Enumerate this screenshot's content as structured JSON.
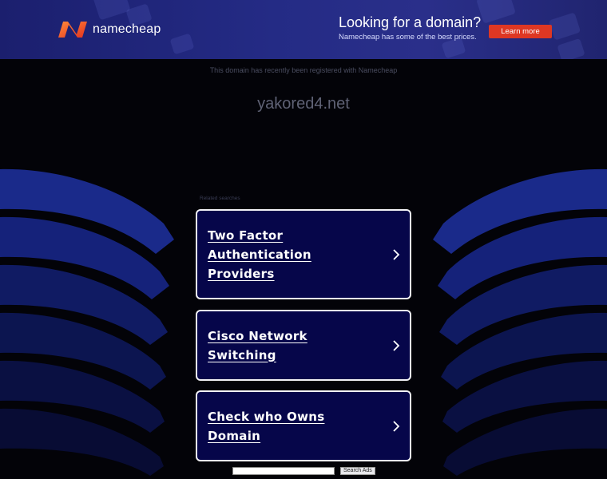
{
  "banner": {
    "brand": "namecheap",
    "promo_title": "Looking for a domain?",
    "promo_subtitle": "Namecheap has some of the best prices.",
    "cta_label": "Learn more",
    "accent_color": "#de3723"
  },
  "main": {
    "notice": "This domain has recently been registered with Namecheap",
    "domain_name": "yakored4.net",
    "related_heading": "Related searches",
    "links": [
      {
        "label": "Two Factor Authentication Providers"
      },
      {
        "label": "Cisco Network Switching"
      },
      {
        "label": "Check who Owns Domain"
      }
    ]
  },
  "search": {
    "input_value": "",
    "button_label": "Search Ads"
  }
}
